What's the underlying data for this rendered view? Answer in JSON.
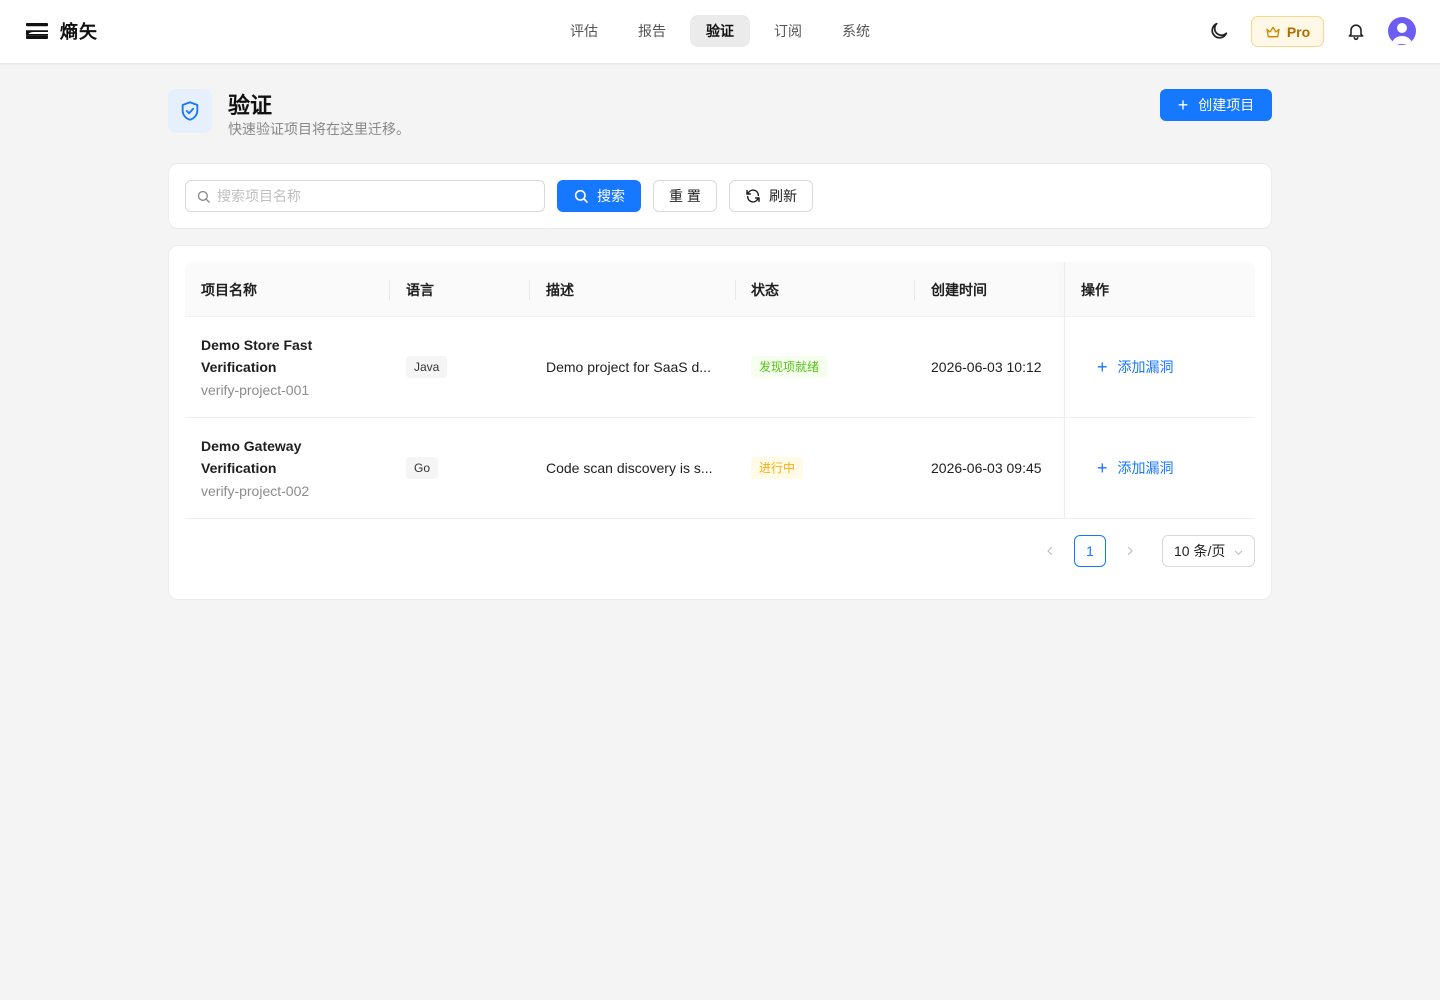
{
  "brand": {
    "name": "熵矢"
  },
  "nav": {
    "items": [
      {
        "label": "评估"
      },
      {
        "label": "报告"
      },
      {
        "label": "验证",
        "active": true
      },
      {
        "label": "订阅"
      },
      {
        "label": "系统"
      }
    ]
  },
  "topbar": {
    "pro_label": "Pro",
    "icons": [
      "moon-icon",
      "crown-icon",
      "bell-icon",
      "avatar"
    ]
  },
  "page": {
    "title": "验证",
    "subtitle": "快速验证项目将在这里迁移。",
    "create_button": "创建项目"
  },
  "search": {
    "placeholder": "搜索项目名称",
    "value": "",
    "search_button": "搜索",
    "reset_button": "重 置",
    "refresh_button": "刷新"
  },
  "table": {
    "columns": [
      "项目名称",
      "语言",
      "描述",
      "状态",
      "创建时间",
      "操作"
    ],
    "rows": [
      {
        "name_line1": "Demo Store Fast",
        "name_line2": "Verification",
        "id": "verify-project-001",
        "language": "Java",
        "description": "Demo project for SaaS d...",
        "status": "发现项就绪",
        "status_kind": "success",
        "created": "2026-06-03 10:12",
        "action": "添加漏洞"
      },
      {
        "name_line1": "Demo Gateway",
        "name_line2": "Verification",
        "id": "verify-project-002",
        "language": "Go",
        "description": "Code scan discovery is s...",
        "status": "进行中",
        "status_kind": "warning",
        "created": "2026-06-03 09:45",
        "action": "添加漏洞"
      }
    ]
  },
  "pagination": {
    "current_page": "1",
    "page_size": "10 条/页"
  },
  "colors": {
    "primary": "#1677ff",
    "success": "#52c41a",
    "warning": "#faad14",
    "pro_accent": "#b26b00"
  }
}
